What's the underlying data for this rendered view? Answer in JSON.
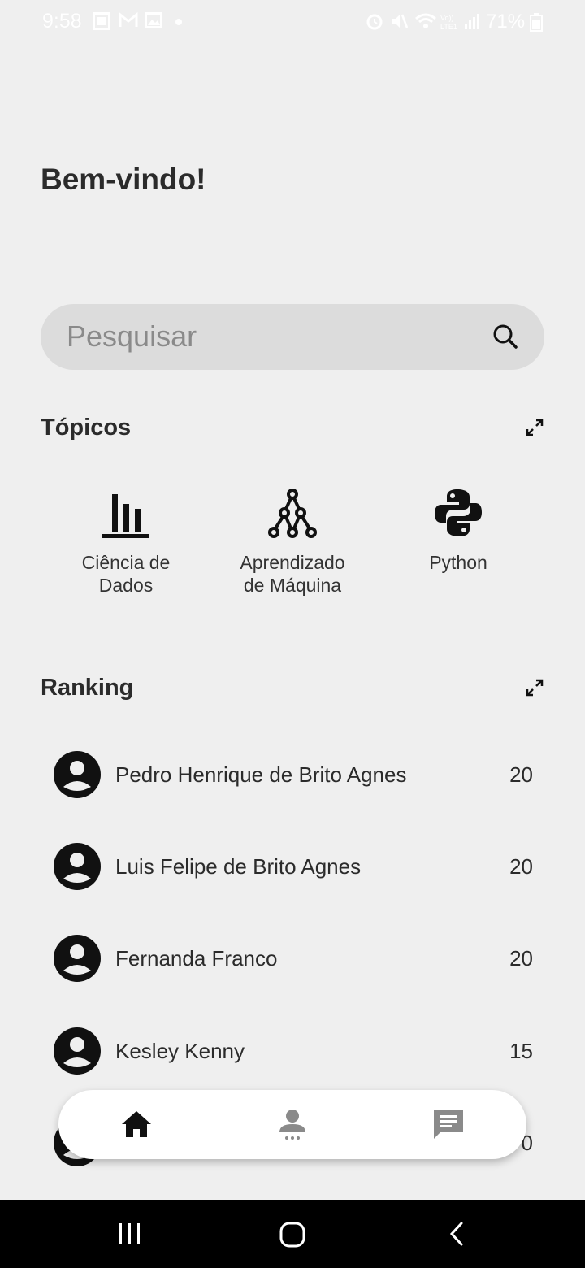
{
  "status_bar": {
    "time": "9:58",
    "battery": "71%",
    "icons": [
      "screenshot-icon",
      "gmail-icon",
      "gallery-icon",
      "dot-icon",
      "alarm-icon",
      "mute-icon",
      "wifi-icon",
      "volte-icon",
      "signal-icon",
      "battery-icon"
    ]
  },
  "greeting": "Bem-vindo!",
  "search": {
    "placeholder": "Pesquisar",
    "value": ""
  },
  "topics": {
    "title": "Tópicos",
    "items": [
      {
        "label": "Ciência de\nDados",
        "icon": "bar-chart-icon"
      },
      {
        "label": "Aprendizado\nde Máquina",
        "icon": "tree-graph-icon"
      },
      {
        "label": "Python",
        "icon": "python-logo-icon"
      }
    ]
  },
  "ranking": {
    "title": "Ranking",
    "items": [
      {
        "name": "Pedro Henrique de Brito Agnes",
        "score": "20"
      },
      {
        "name": "Luis Felipe de Brito Agnes",
        "score": "20"
      },
      {
        "name": "Fernanda Franco",
        "score": "20"
      },
      {
        "name": "Kesley Kenny",
        "score": "15"
      },
      {
        "name": "",
        "score": "0"
      }
    ]
  },
  "tab_bar": {
    "tabs": [
      {
        "icon": "home-icon",
        "active": true
      },
      {
        "icon": "person-icon",
        "active": false
      },
      {
        "icon": "chat-icon",
        "active": false
      }
    ]
  },
  "colors": {
    "background": "#efefef",
    "search_bg": "#dcdcdc",
    "text": "#2b2b2b",
    "inactive_icon": "#8a8a8a"
  }
}
